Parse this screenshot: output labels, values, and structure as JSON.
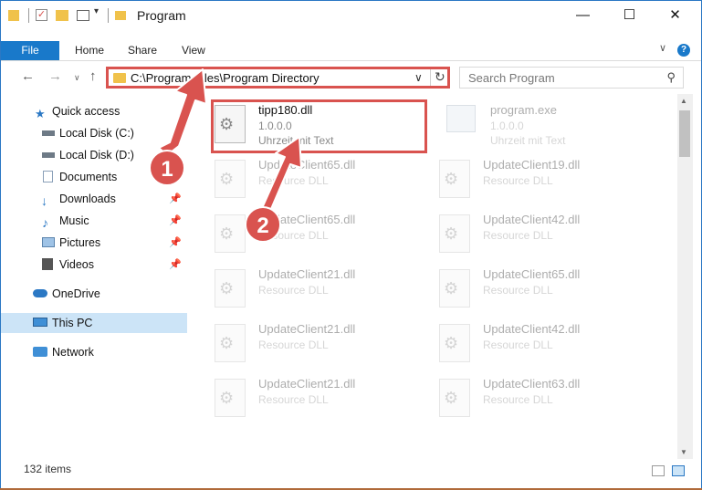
{
  "window": {
    "title": "Program"
  },
  "ribbon": {
    "file": "File",
    "home": "Home",
    "share": "Share",
    "view": "View"
  },
  "address": {
    "path": "C:\\Program Files\\Program Directory"
  },
  "search": {
    "placeholder": "Search Program"
  },
  "sidebar": {
    "items": [
      {
        "label": "Quick access"
      },
      {
        "label": "Local Disk (C:)"
      },
      {
        "label": "Local Disk (D:)"
      },
      {
        "label": "Documents"
      },
      {
        "label": "Downloads"
      },
      {
        "label": "Music"
      },
      {
        "label": "Pictures"
      },
      {
        "label": "Videos"
      },
      {
        "label": "OneDrive"
      },
      {
        "label": "This PC"
      },
      {
        "label": "Network"
      }
    ]
  },
  "files": {
    "main": {
      "name": "tipp180.dll",
      "version": "1.0.0.0",
      "desc": "Uhrzeit mit Text"
    },
    "exe": {
      "name": "program.exe",
      "version": "1.0.0.0",
      "desc": "Uhrzeit mit Text"
    },
    "list": [
      {
        "name": "UpdateClient65.dll",
        "desc": "Resource DLL"
      },
      {
        "name": "UpdateClient19.dll",
        "desc": "Resource DLL"
      },
      {
        "name": "UpdateClient65.dll",
        "desc": "Resource DLL"
      },
      {
        "name": "UpdateClient42.dll",
        "desc": "Resource DLL"
      },
      {
        "name": "UpdateClient21.dll",
        "desc": "Resource DLL"
      },
      {
        "name": "UpdateClient65.dll",
        "desc": "Resource DLL"
      },
      {
        "name": "UpdateClient21.dll",
        "desc": "Resource DLL"
      },
      {
        "name": "UpdateClient42.dll",
        "desc": "Resource DLL"
      },
      {
        "name": "UpdateClient21.dll",
        "desc": "Resource DLL"
      },
      {
        "name": "UpdateClient63.dll",
        "desc": "Resource DLL"
      }
    ]
  },
  "status": {
    "count": "132 items"
  },
  "callouts": {
    "one": "1",
    "two": "2"
  },
  "colors": {
    "accent": "#1979ca",
    "highlight": "#d9534f",
    "selected": "#cce4f7"
  }
}
